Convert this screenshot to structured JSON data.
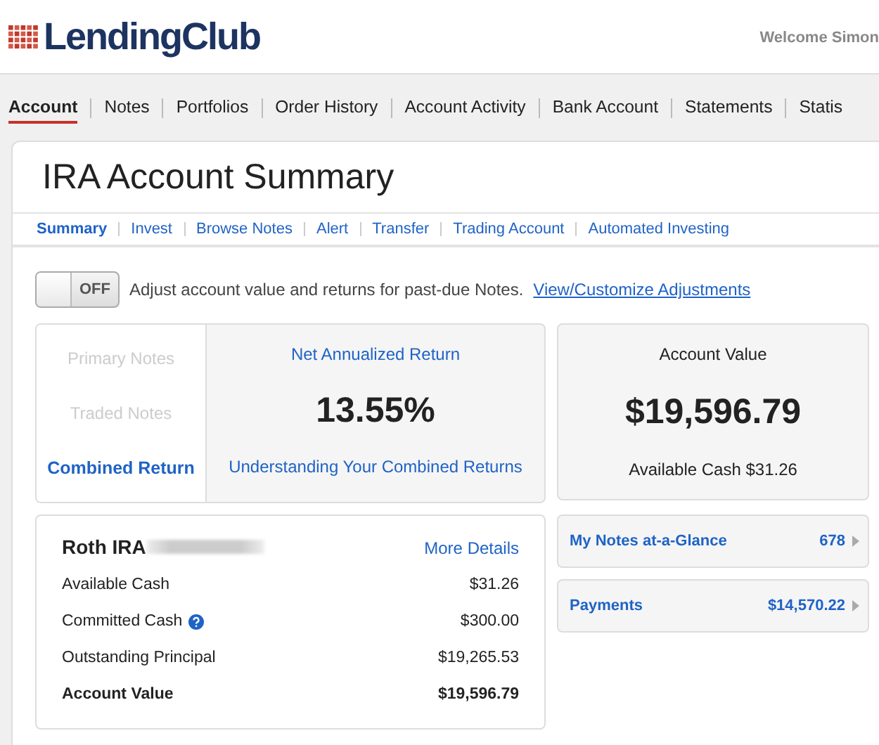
{
  "header": {
    "logo": "LendingClub",
    "welcome": "Welcome Simon"
  },
  "nav": [
    {
      "label": "Account",
      "selected": true
    },
    {
      "label": "Notes",
      "selected": false
    },
    {
      "label": "Portfolios",
      "selected": false
    },
    {
      "label": "Order History",
      "selected": false
    },
    {
      "label": "Account Activity",
      "selected": false
    },
    {
      "label": "Bank Account",
      "selected": false
    },
    {
      "label": "Statements",
      "selected": false
    },
    {
      "label": "Statis",
      "selected": false
    }
  ],
  "page": {
    "title": "IRA Account Summary"
  },
  "subnav": [
    {
      "label": "Summary",
      "selected": true
    },
    {
      "label": "Invest",
      "selected": false
    },
    {
      "label": "Browse Notes",
      "selected": false
    },
    {
      "label": "Alert",
      "selected": false
    },
    {
      "label": "Transfer",
      "selected": false
    },
    {
      "label": "Trading Account",
      "selected": false
    },
    {
      "label": "Automated Investing",
      "selected": false
    }
  ],
  "adjust_toggle": {
    "on": false,
    "label": "OFF",
    "text": "Adjust account value and returns for past-due Notes.",
    "link": "View/Customize Adjustments"
  },
  "return_tabs": [
    {
      "label": "Primary Notes",
      "selected": false
    },
    {
      "label": "Traded Notes",
      "selected": false
    },
    {
      "label": "Combined Return",
      "selected": true
    }
  ],
  "return_panel": {
    "heading": "Net Annualized Return",
    "value": "13.55%",
    "link": "Understanding Your Combined Returns"
  },
  "account_value": {
    "heading": "Account Value",
    "value": "$19,596.79",
    "available": "Available Cash $31.26"
  },
  "account_card": {
    "title": "Roth IRA",
    "link": "More Details",
    "rows": [
      {
        "label": "Available Cash",
        "value": "$31.26",
        "bold": false,
        "help": false
      },
      {
        "label": "Committed Cash",
        "value": "$300.00",
        "bold": false,
        "help": true
      },
      {
        "label": "Outstanding Principal",
        "value": "$19,265.53",
        "bold": false,
        "help": false
      },
      {
        "label": "Account Value",
        "value": "$19,596.79",
        "bold": true,
        "help": false
      }
    ]
  },
  "side_links": [
    {
      "label": "My Notes at-a-Glance",
      "value": "678"
    },
    {
      "label": "Payments",
      "value": "$14,570.22"
    }
  ]
}
